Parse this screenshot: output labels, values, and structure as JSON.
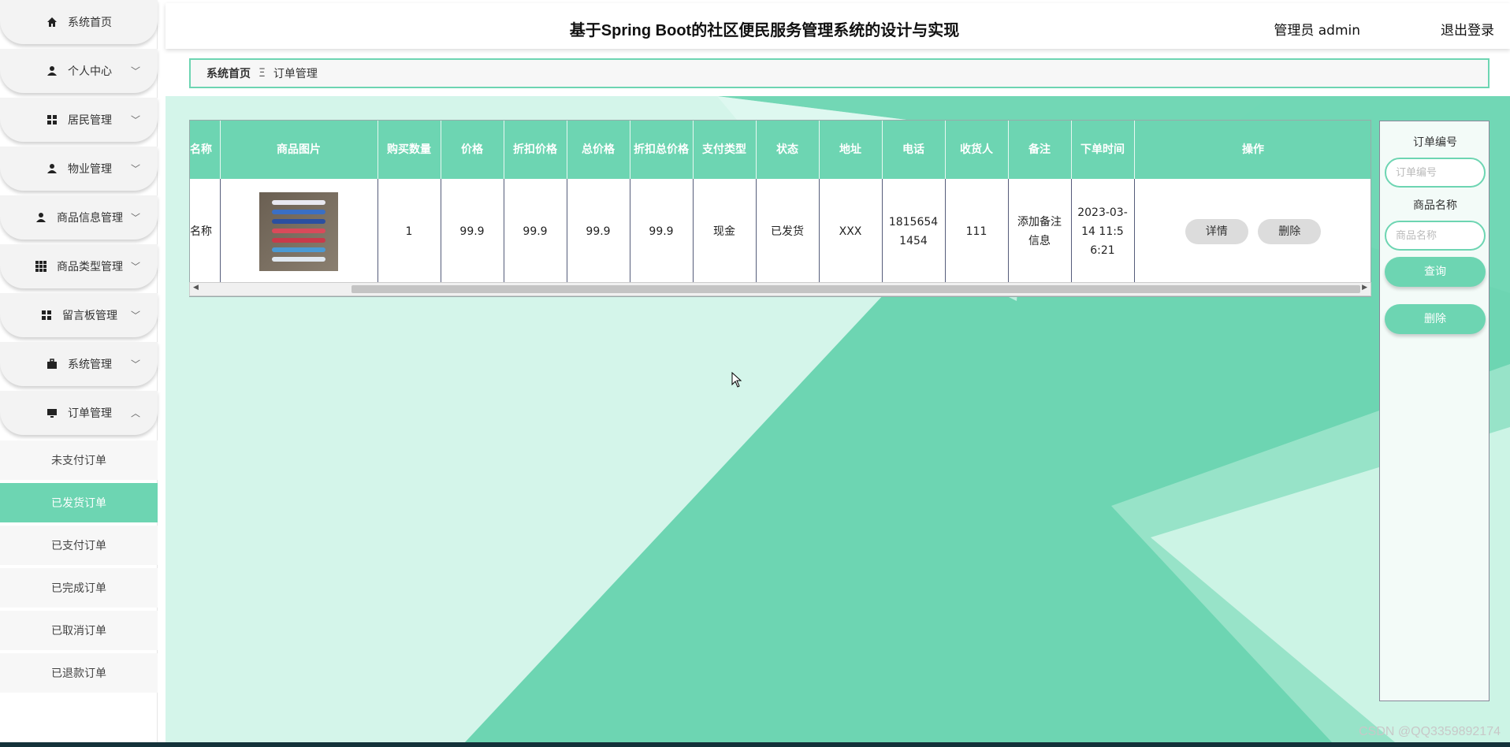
{
  "sidebar": {
    "items": [
      {
        "label": "系统首页",
        "icon": "home-icon"
      },
      {
        "label": "个人中心",
        "icon": "user-icon"
      },
      {
        "label": "居民管理",
        "icon": "grid-icon"
      },
      {
        "label": "物业管理",
        "icon": "user-icon"
      },
      {
        "label": "商品信息管理",
        "icon": "user-icon"
      },
      {
        "label": "商品类型管理",
        "icon": "grid9-icon"
      },
      {
        "label": "留言板管理",
        "icon": "grid-icon"
      },
      {
        "label": "系统管理",
        "icon": "briefcase-icon"
      },
      {
        "label": "订单管理",
        "icon": "monitor-icon"
      }
    ],
    "subitems": [
      "未支付订单",
      "已发货订单",
      "已支付订单",
      "已完成订单",
      "已取消订单",
      "已退款订单"
    ],
    "active_subitem": "已发货订单"
  },
  "header": {
    "title": "基于Spring Boot的社区便民服务管理系统的设计与实现",
    "admin": "管理员 admin",
    "logout": "退出登录"
  },
  "breadcrumb": {
    "home": "系统首页",
    "sep": "Ξ",
    "current": "订单管理"
  },
  "table": {
    "columns": [
      "名称",
      "商品图片",
      "购买数量",
      "价格",
      "折扣价格",
      "总价格",
      "折扣总价格",
      "支付类型",
      "状态",
      "地址",
      "电话",
      "收货人",
      "备注",
      "下单时间",
      "操作"
    ],
    "row": {
      "name": "名称",
      "quantity": "1",
      "price": "99.9",
      "discount_price": "99.9",
      "total": "99.9",
      "discount_total": "99.9",
      "pay_type": "现金",
      "status": "已发货",
      "address": "XXX",
      "phone": "18156541454",
      "receiver": "111",
      "remark": "添加备注信息",
      "order_time": "2023-03-14 11:56:21",
      "detail_btn": "详情",
      "delete_btn": "删除"
    }
  },
  "search": {
    "order_no_label": "订单编号",
    "order_no_placeholder": "订单编号",
    "product_name_label": "商品名称",
    "product_name_placeholder": "商品名称",
    "query_btn": "查询",
    "delete_btn": "删除"
  },
  "watermark": "CSDN @QQ3359892174",
  "colors": {
    "accent": "#6dd5b2",
    "background": "#d4f5ea"
  }
}
